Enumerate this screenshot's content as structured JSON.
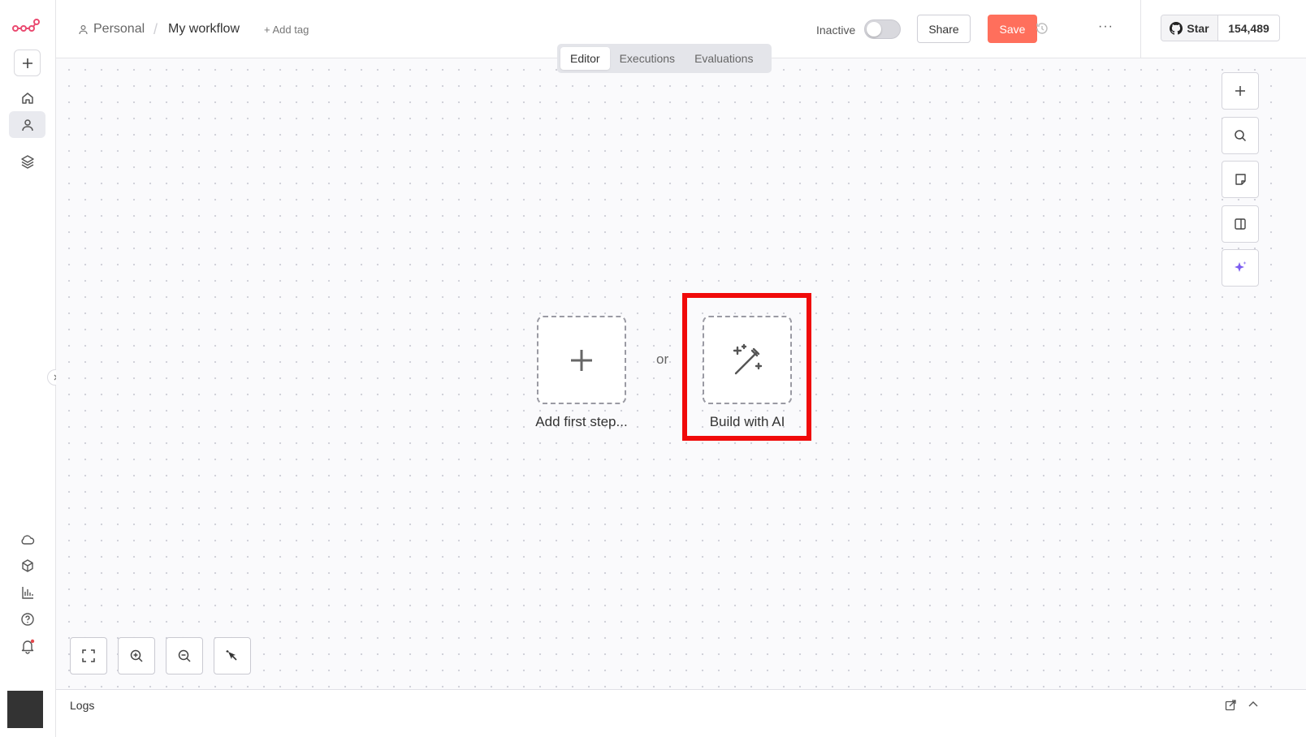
{
  "header": {
    "project": "Personal",
    "separator": "/",
    "workflow_name": "My workflow",
    "add_tag": "+ Add tag",
    "status_label": "Inactive",
    "share_label": "Share",
    "save_label": "Save",
    "more_label": "···",
    "github_star": "Star",
    "github_count": "154,489"
  },
  "tabs": [
    {
      "label": "Editor",
      "active": true
    },
    {
      "label": "Executions",
      "active": false
    },
    {
      "label": "Evaluations",
      "active": false
    }
  ],
  "canvas": {
    "add_step_label": "Add first step...",
    "or_label": "or",
    "build_ai_label": "Build with AI"
  },
  "right_tools": [
    "plus-icon",
    "search-icon",
    "sticky-note-icon",
    "panel-icon",
    "sparkle-icon"
  ],
  "zoom_tools": [
    "fit-view-icon",
    "zoom-in-icon",
    "zoom-out-icon",
    "tidy-up-icon"
  ],
  "sidebar": {
    "top": [
      "home-icon",
      "user-icon",
      "layers-icon"
    ],
    "bottom": [
      "cloud-icon",
      "package-icon",
      "chart-icon",
      "help-icon",
      "bell-icon"
    ]
  },
  "logs": {
    "label": "Logs"
  },
  "colors": {
    "brand": "#ea4b71",
    "save": "#ff6f5c",
    "highlight": "#f00a0a",
    "ai_accent": "#7b5cf0"
  }
}
